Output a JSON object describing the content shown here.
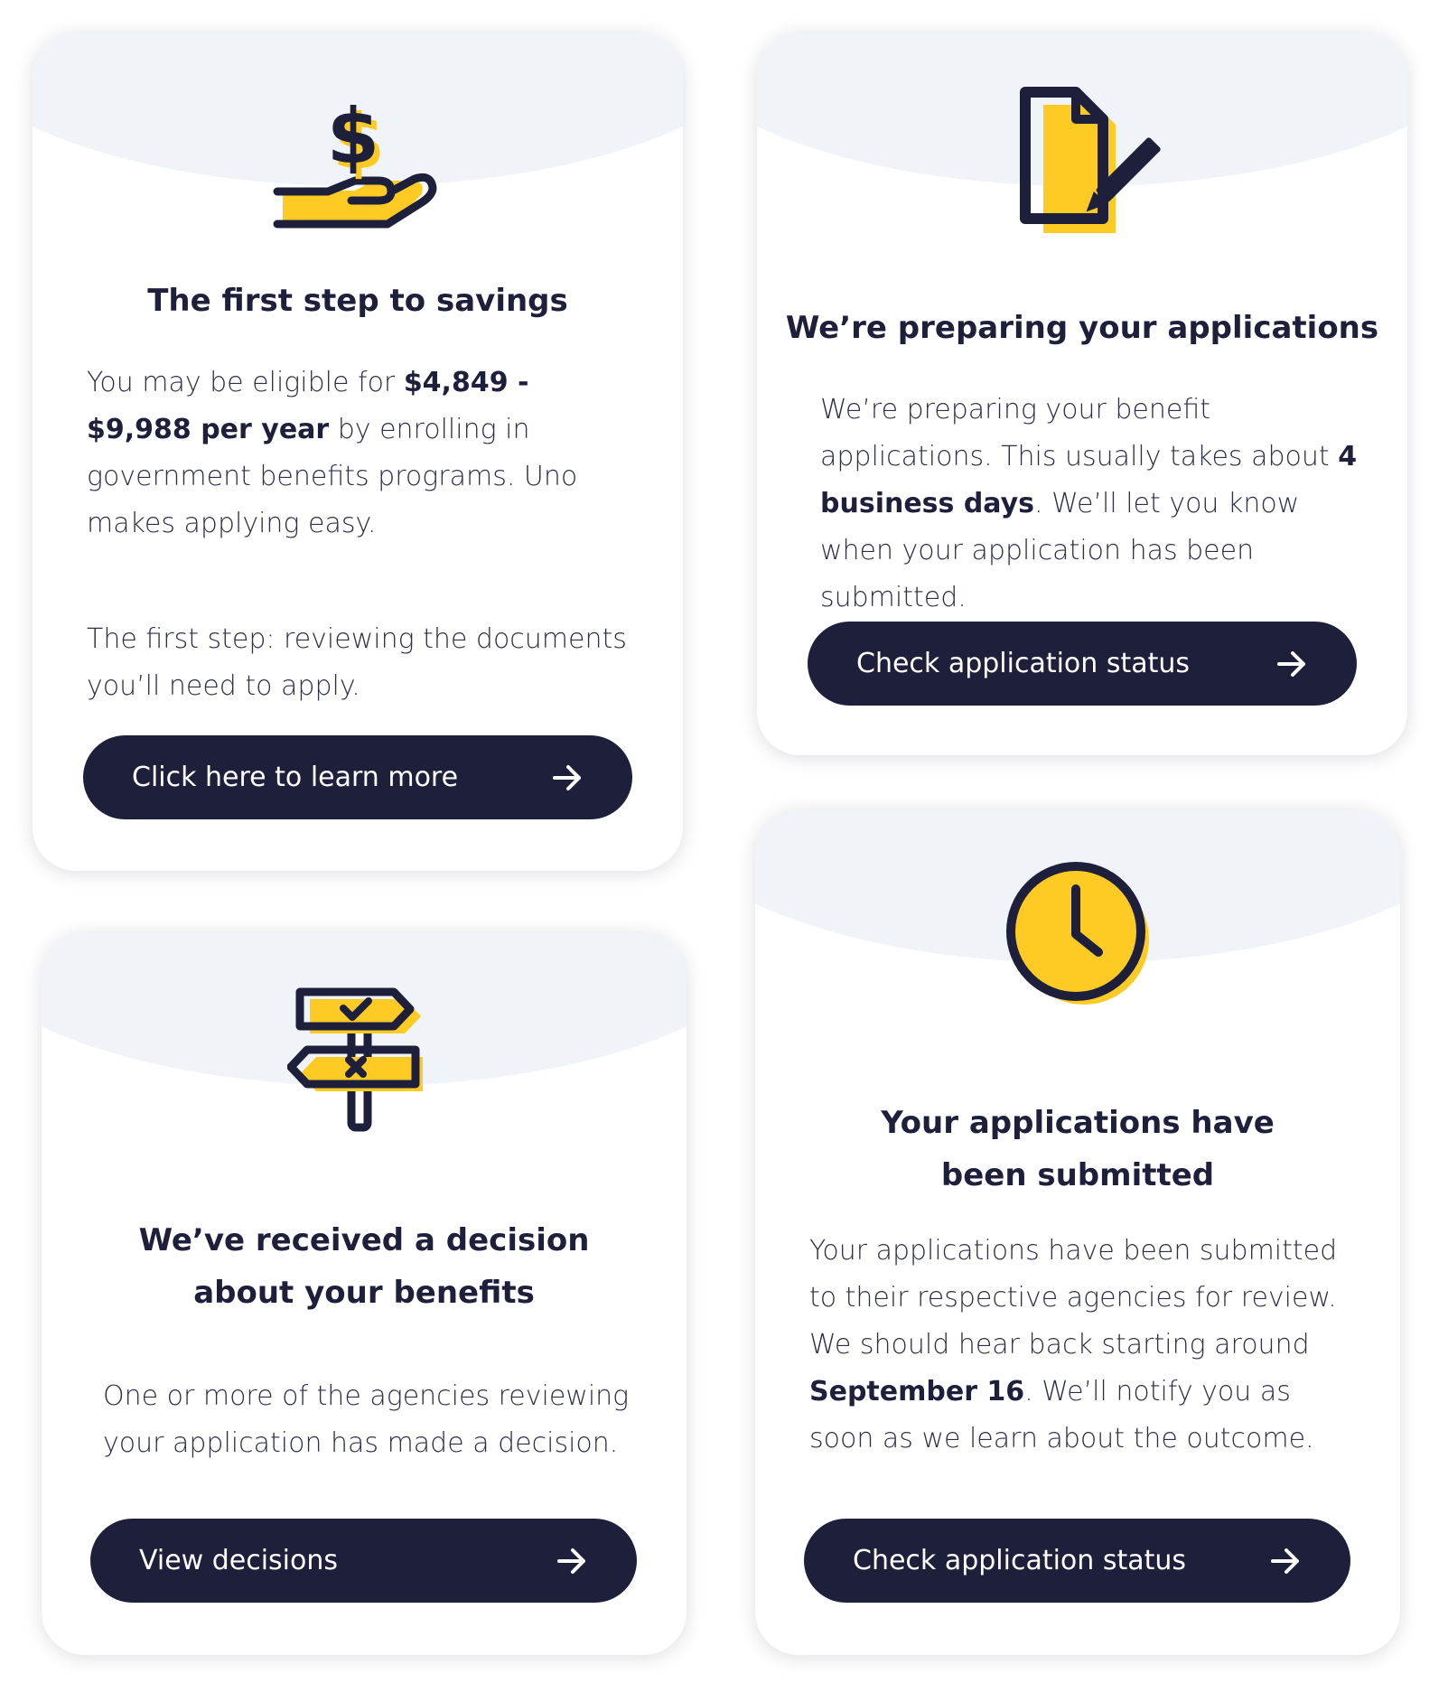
{
  "colors": {
    "navy": "#1e1f3b",
    "yellow": "#fdcb24",
    "tint": "#f0f3f8"
  },
  "cards": [
    {
      "icon": "hand-dollar-icon",
      "title": "The first step to savings",
      "body": {
        "t1": "You may be eligible for ",
        "amount": "$4,849 - $9,988 per year",
        "t2": " by enrolling in government benefits programs. Uno makes applying easy.",
        "p2": "The first step: reviewing the documents you’ll need to apply."
      },
      "button": "Click here to learn more"
    },
    {
      "icon": "document-pencil-icon",
      "title": "We’re preparing your applications",
      "body": {
        "t1": "We’re preparing your benefit applications. This usually takes about ",
        "days": "4 business days",
        "t2": ". We’ll let you know when your application has been submitted."
      },
      "button": "Check application status"
    },
    {
      "icon": "signpost-icon",
      "title": "We’ve received a decision about your benefits",
      "body": "One or more of the agencies reviewing your application has made a decision.",
      "button": "View decisions"
    },
    {
      "icon": "clock-icon",
      "title": "Your applications have been submitted",
      "body": {
        "t1": "Your applications have been submitted to their respective agencies for review. We should hear back starting around ",
        "date": "September 16",
        "t2": ". We’ll notify you as soon as we learn about the outcome."
      },
      "button": "Check application status"
    }
  ]
}
